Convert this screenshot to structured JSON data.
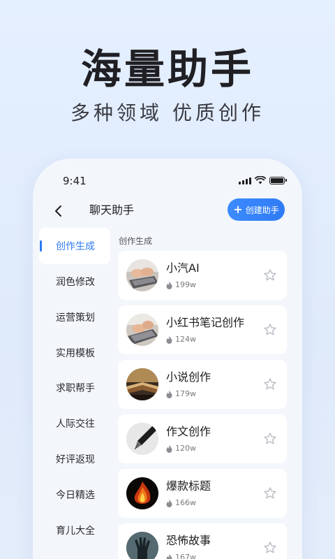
{
  "hero": {
    "title": "海量助手",
    "subtitle": "多种领域 优质创作"
  },
  "status_bar": {
    "time": "9:41",
    "icons": [
      "signal-icon",
      "wifi-icon",
      "battery-icon"
    ]
  },
  "nav": {
    "back_icon": "chevron-left-icon",
    "title": "聊天助手",
    "create_button": {
      "icon": "plus-icon",
      "label": "创建助手"
    }
  },
  "sidebar": {
    "items": [
      {
        "label": "创作生成",
        "active": true
      },
      {
        "label": "润色修改"
      },
      {
        "label": "运营策划"
      },
      {
        "label": "实用模板"
      },
      {
        "label": "求职帮手"
      },
      {
        "label": "人际交往"
      },
      {
        "label": "好评返现"
      },
      {
        "label": "今日精选"
      },
      {
        "label": "育儿大全"
      }
    ]
  },
  "section": {
    "label": "创作生成"
  },
  "assistants": [
    {
      "name": "小汽AI",
      "count": "199w",
      "avatar": "typing-laptop-avatar"
    },
    {
      "name": "小红书笔记创作",
      "count": "124w",
      "avatar": "typing-laptop-avatar"
    },
    {
      "name": "小说创作",
      "count": "179w",
      "avatar": "open-book-avatar"
    },
    {
      "name": "作文创作",
      "count": "120w",
      "avatar": "fountain-pen-avatar"
    },
    {
      "name": "爆款标题",
      "count": "166w",
      "avatar": "flames-avatar"
    },
    {
      "name": "恐怖故事",
      "count": "167w",
      "avatar": "dark-hand-avatar"
    }
  ],
  "colors": {
    "accent": "#2f7bf5",
    "background": "#e4efff",
    "card": "#ffffff"
  }
}
